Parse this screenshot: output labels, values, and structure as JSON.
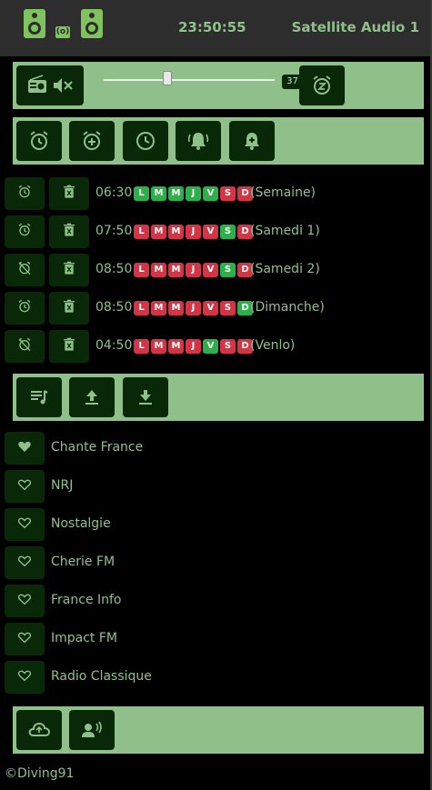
{
  "header": {
    "clock": "23:50:55",
    "device_name": "Satellite Audio 1",
    "icons": [
      "speaker-icon",
      "radio-wave-icon",
      "speaker-icon"
    ]
  },
  "player": {
    "volume": "37",
    "volume_level_percent": 37,
    "icons": [
      "radio-icon",
      "mute-icon",
      "snooze-icon"
    ]
  },
  "alarm_toolbar": {
    "icons": [
      "alarm-icon",
      "alarm-add-icon",
      "clock-icon",
      "bell-ring-icon",
      "bell-add-icon"
    ]
  },
  "alarms": [
    {
      "time": "06:30",
      "label": "(Semaine)",
      "enabled": true,
      "days": [
        {
          "l": "L",
          "on": true
        },
        {
          "l": "M",
          "on": true
        },
        {
          "l": "M",
          "on": true
        },
        {
          "l": "J",
          "on": true
        },
        {
          "l": "V",
          "on": true
        },
        {
          "l": "S",
          "on": false
        },
        {
          "l": "D",
          "on": false
        }
      ]
    },
    {
      "time": "07:50",
      "label": "(Samedi 1)",
      "enabled": true,
      "days": [
        {
          "l": "L",
          "on": false
        },
        {
          "l": "M",
          "on": false
        },
        {
          "l": "M",
          "on": false
        },
        {
          "l": "J",
          "on": false
        },
        {
          "l": "V",
          "on": false
        },
        {
          "l": "S",
          "on": true
        },
        {
          "l": "D",
          "on": false
        }
      ]
    },
    {
      "time": "08:50",
      "label": "(Samedi 2)",
      "enabled": false,
      "days": [
        {
          "l": "L",
          "on": false
        },
        {
          "l": "M",
          "on": false
        },
        {
          "l": "M",
          "on": false
        },
        {
          "l": "J",
          "on": false
        },
        {
          "l": "V",
          "on": false
        },
        {
          "l": "S",
          "on": true
        },
        {
          "l": "D",
          "on": false
        }
      ]
    },
    {
      "time": "08:50",
      "label": "(Dimanche)",
      "enabled": true,
      "days": [
        {
          "l": "L",
          "on": false
        },
        {
          "l": "M",
          "on": false
        },
        {
          "l": "M",
          "on": false
        },
        {
          "l": "J",
          "on": false
        },
        {
          "l": "V",
          "on": false
        },
        {
          "l": "S",
          "on": false
        },
        {
          "l": "D",
          "on": true
        }
      ]
    },
    {
      "time": "04:50",
      "label": "(Venlo)",
      "enabled": false,
      "days": [
        {
          "l": "L",
          "on": false
        },
        {
          "l": "M",
          "on": false
        },
        {
          "l": "M",
          "on": false
        },
        {
          "l": "J",
          "on": false
        },
        {
          "l": "V",
          "on": true
        },
        {
          "l": "S",
          "on": false
        },
        {
          "l": "D",
          "on": false
        }
      ]
    }
  ],
  "playlist_toolbar": {
    "icons": [
      "playlist-icon",
      "upload-icon",
      "download-icon"
    ]
  },
  "stations": [
    {
      "name": "Chante France",
      "favorite": true
    },
    {
      "name": "NRJ",
      "favorite": false
    },
    {
      "name": "Nostalgie",
      "favorite": false
    },
    {
      "name": "Cherie FM",
      "favorite": false
    },
    {
      "name": "France Info",
      "favorite": false
    },
    {
      "name": "Impact FM",
      "favorite": false
    },
    {
      "name": "Radio Classique",
      "favorite": false
    }
  ],
  "bottom_toolbar": {
    "icons": [
      "cloud-icon",
      "voice-icon"
    ]
  },
  "footer": {
    "credit": "©Diving91"
  },
  "colors": {
    "panel": "#8fc08a",
    "button": "#082808",
    "day_on": "#2bb04a",
    "day_off": "#d63344",
    "text": "#8fc08a"
  }
}
